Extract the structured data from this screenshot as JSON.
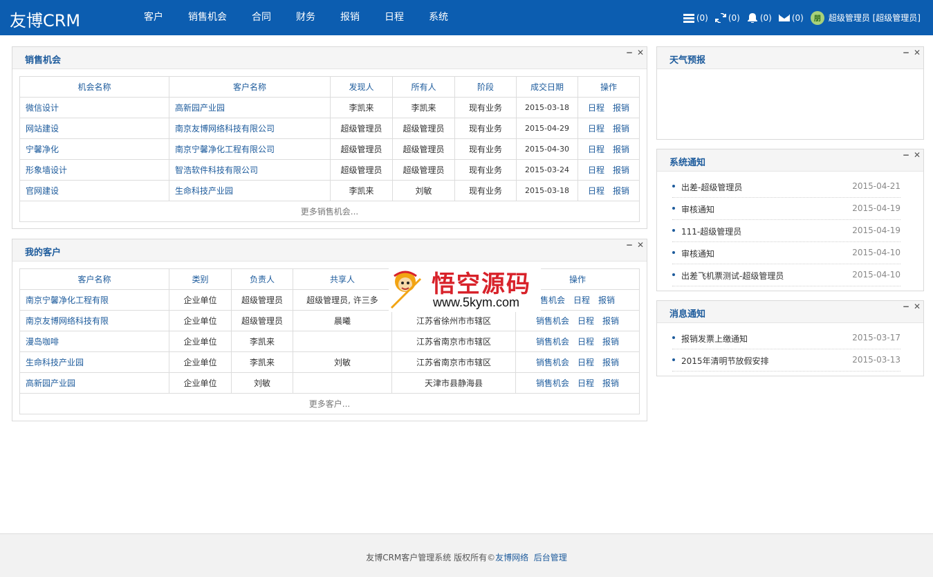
{
  "app": {
    "brand": "友博CRM"
  },
  "nav": [
    "客户",
    "销售机会",
    "合同",
    "财务",
    "报销",
    "日程",
    "系统"
  ],
  "toolbar": {
    "tasks_count": "(0)",
    "sync_count": "(0)",
    "alerts_count": "(0)",
    "mail_count": "(0)",
    "avatar_text": "朋",
    "user_label": "超级管理员 [超级管理员]"
  },
  "sales": {
    "title": "销售机会",
    "headers": [
      "机会名称",
      "客户名称",
      "发现人",
      "所有人",
      "阶段",
      "成交日期",
      "操作"
    ],
    "rows": [
      [
        "微信设计",
        "高新园产业园",
        "李凯来",
        "李凯来",
        "现有业务",
        "2015-03-18"
      ],
      [
        "网站建设",
        "南京友博网络科技有限公司",
        "超级管理员",
        "超级管理员",
        "现有业务",
        "2015-04-29"
      ],
      [
        "宁馨净化",
        "南京宁馨净化工程有限公司",
        "超级管理员",
        "超级管理员",
        "现有业务",
        "2015-04-30"
      ],
      [
        "形象墙设计",
        "智浩软件科技有限公司",
        "超级管理员",
        "超级管理员",
        "现有业务",
        "2015-03-24"
      ],
      [
        "官网建设",
        "生命科技产业园",
        "李凯来",
        "刘敏",
        "现有业务",
        "2015-03-18"
      ]
    ],
    "op_schedule": "日程",
    "op_expense": "报销",
    "more": "更多销售机会..."
  },
  "customers": {
    "title": "我的客户",
    "headers": [
      "客户名称",
      "类别",
      "负责人",
      "共享人",
      "",
      "操作"
    ],
    "rows": [
      [
        "南京宁馨净化工程有限",
        "企业单位",
        "超级管理员",
        "超级管理员, 许三多",
        ""
      ],
      [
        "南京友博网络科技有限",
        "企业单位",
        "超级管理员",
        "晨曦",
        "江苏省徐州市市辖区"
      ],
      [
        "漫岛咖啡",
        "企业单位",
        "李凯来",
        "",
        "江苏省南京市市辖区"
      ],
      [
        "生命科技产业园",
        "企业单位",
        "李凯来",
        "刘敏",
        "江苏省南京市市辖区"
      ],
      [
        "高新园产业园",
        "企业单位",
        "刘敏",
        "",
        "天津市县静海县"
      ]
    ],
    "op_sales": "销售机会",
    "op_sales_partial": "售机会",
    "op_schedule": "日程",
    "op_expense": "报销",
    "more": "更多客户..."
  },
  "weather": {
    "title": "天气预报"
  },
  "system_notice": {
    "title": "系统通知",
    "items": [
      {
        "text": "出差-超级管理员",
        "date": "2015-04-21"
      },
      {
        "text": "审核通知",
        "date": "2015-04-19"
      },
      {
        "text": "111-超级管理员",
        "date": "2015-04-19"
      },
      {
        "text": "审核通知",
        "date": "2015-04-10"
      },
      {
        "text": "出差飞机票测试-超级管理员",
        "date": "2015-04-10"
      }
    ]
  },
  "message_notice": {
    "title": "消息通知",
    "items": [
      {
        "text": "报销发票上缴通知",
        "date": "2015-03-17"
      },
      {
        "text": "2015年清明节放假安排",
        "date": "2015-03-13"
      }
    ]
  },
  "panel_controls": {
    "minimize": "−",
    "close": "✕"
  },
  "watermark": {
    "title": "悟空源码",
    "url": "www.5kym.com"
  },
  "footer": {
    "text": "友博CRM客户管理系统  版权所有©",
    "company": "友博网络",
    "admin": "后台管理"
  },
  "colors": {
    "header_bg": "#0c5db0",
    "link": "#1d5b9c"
  }
}
